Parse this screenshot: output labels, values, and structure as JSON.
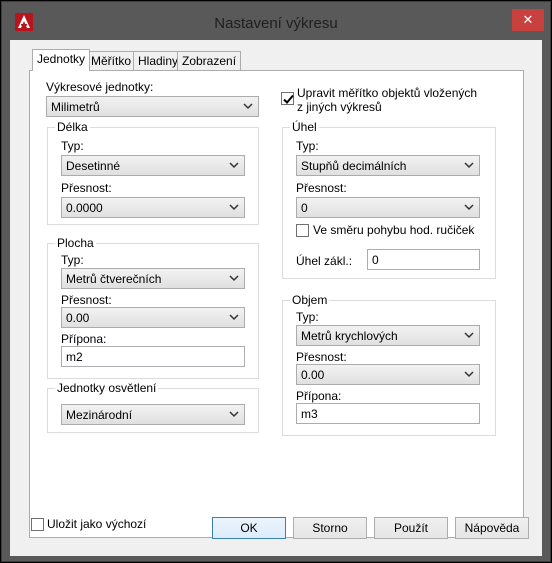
{
  "window": {
    "title": "Nastavení výkresu",
    "close_label": "✕"
  },
  "tabs": [
    "Jednotky",
    "Měřítko",
    "Hladiny",
    "Zobrazení"
  ],
  "drawing_units": {
    "label": "Výkresové jednotky:",
    "value": "Milimetrů"
  },
  "scale_inserted": {
    "line1": "Upravit měřítko objektů vložených",
    "line2": "z jiných výkresů",
    "checked": true
  },
  "length": {
    "title": "Délka",
    "type_label": "Typ:",
    "type_value": "Desetinné",
    "precision_label": "Přesnost:",
    "precision_value": "0.0000"
  },
  "area": {
    "title": "Plocha",
    "type_label": "Typ:",
    "type_value": "Metrů čtverečních",
    "precision_label": "Přesnost:",
    "precision_value": "0.00",
    "suffix_label": "Přípona:",
    "suffix_value": "m2"
  },
  "lighting": {
    "title": "Jednotky osvětlení",
    "value": "Mezinárodní"
  },
  "angle": {
    "title": "Úhel",
    "type_label": "Typ:",
    "type_value": "Stupňů decimálních",
    "precision_label": "Přesnost:",
    "precision_value": "0",
    "clockwise_label": "Ve směru pohybu hod. ručiček",
    "clockwise_checked": false,
    "base_label": "Úhel zákl.:",
    "base_value": "0"
  },
  "volume": {
    "title": "Objem",
    "type_label": "Typ:",
    "type_value": "Metrů krychlových",
    "precision_label": "Přesnost:",
    "precision_value": "0.00",
    "suffix_label": "Přípona:",
    "suffix_value": "m3"
  },
  "save_default": {
    "label": "Uložit jako výchozí",
    "checked": false
  },
  "buttons": {
    "ok": "OK",
    "cancel": "Storno",
    "apply": "Použít",
    "help": "Nápověda"
  },
  "colors": {
    "accent": "#c9413e",
    "window_frame": "#595959",
    "default_button_border": "#3c7fb1"
  }
}
